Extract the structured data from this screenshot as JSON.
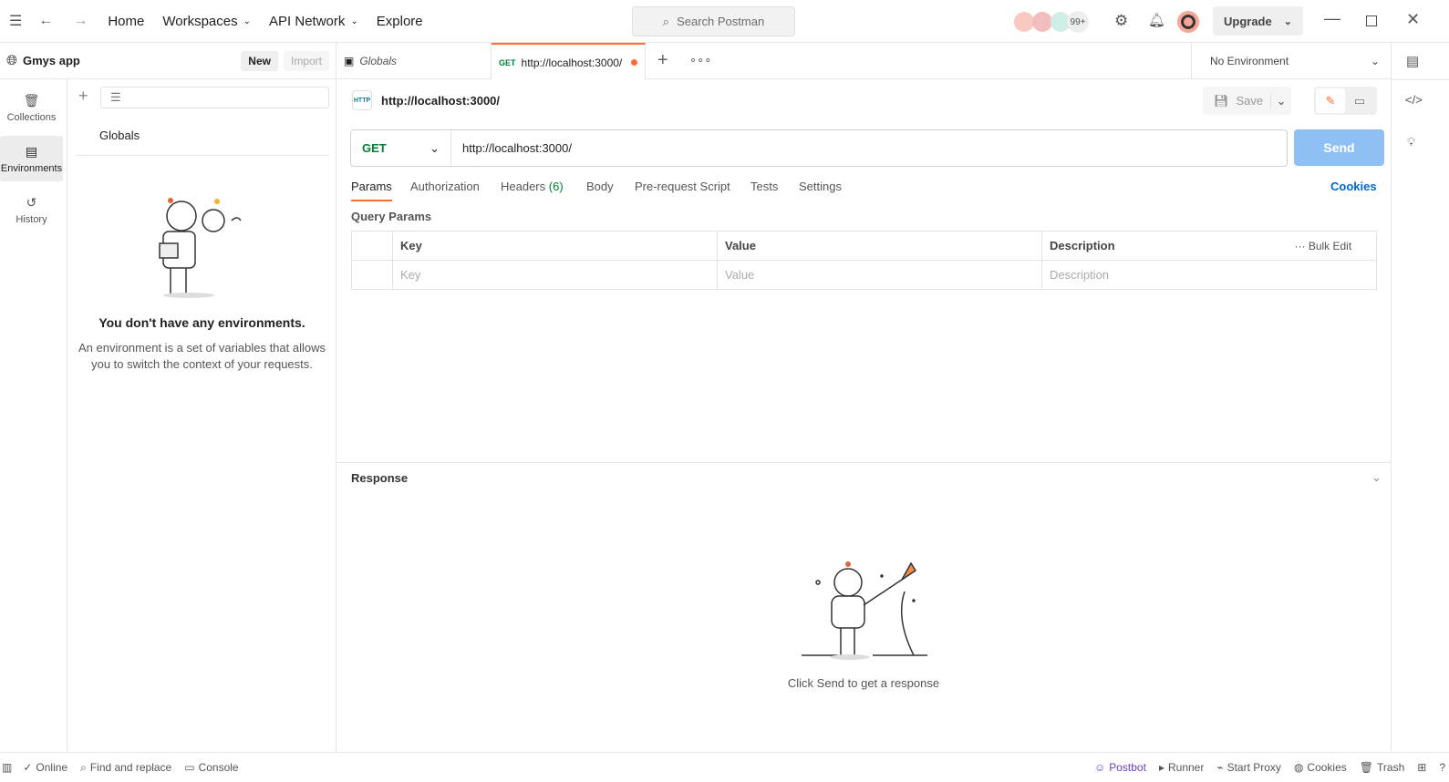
{
  "topbar": {
    "nav": [
      "Home",
      "Workspaces",
      "API Network",
      "Explore"
    ],
    "search_placeholder": "Search Postman",
    "avatars_count": "99+",
    "upgrade": "Upgrade"
  },
  "sidebar": {
    "workspace": "Gmys app",
    "new": "New",
    "import": "Import",
    "rail": [
      "Collections",
      "Environments",
      "History"
    ],
    "globals": "Globals",
    "empty_title": "You don't have any environments.",
    "empty_text": "An environment is a set of variables that allows you to switch the context of your requests."
  },
  "tabs": {
    "globals": "Globals",
    "active_method": "GET",
    "active_url": "http://localhost:3000/",
    "environment": "No Environment",
    "unsaved_color": "#ff6c37"
  },
  "request": {
    "title": "http://localhost:3000/",
    "save": "Save",
    "method": "GET",
    "url": "http://localhost:3000/",
    "send": "Send",
    "tabs": [
      "Params",
      "Authorization",
      "Headers",
      "Body",
      "Pre-request Script",
      "Tests",
      "Settings"
    ],
    "headers_count": "(6)",
    "cookies": "Cookies",
    "query_params": "Query Params",
    "columns": [
      "Key",
      "Value",
      "Description"
    ],
    "bulk_edit": "Bulk Edit",
    "placeholders": [
      "Key",
      "Value",
      "Description"
    ]
  },
  "response": {
    "title": "Response",
    "hint": "Click Send to get a response"
  },
  "status": {
    "left": [
      "Online",
      "Find and replace",
      "Console"
    ],
    "right": [
      "Postbot",
      "Runner",
      "Start Proxy",
      "Cookies",
      "Trash"
    ]
  },
  "colors": {
    "accent": "#ff6c37",
    "send": "#8fc0f5",
    "link": "#0265d2",
    "get": "#007f31"
  }
}
